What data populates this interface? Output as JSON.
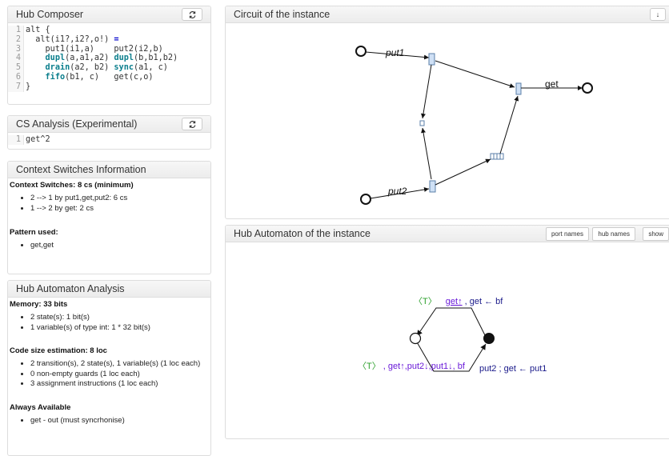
{
  "hub_composer": {
    "title": "Hub Composer",
    "line_numbers": [
      "1",
      "2",
      "3",
      "4",
      "5",
      "6",
      "7"
    ],
    "code": {
      "l1": "alt {",
      "l2a": "  alt(i1?,i2?,o!) ",
      "l2b": "=",
      "l3": "    put1(i1,a)    put2(i2,b)",
      "l4_kw1": "dupl",
      "l4_a": "(a,a1,a2) ",
      "l4_kw2": "dupl",
      "l4_b": "(b,b1,b2)",
      "l5_kw1": "drain",
      "l5_a": "(a2, b2) ",
      "l5_kw2": "sync",
      "l5_b": "(a1, c)",
      "l6_kw1": "fifo",
      "l6_a": "(b1, c)   get(c,o)",
      "l7": "}"
    }
  },
  "cs_analysis": {
    "title": "CS Analysis (Experimental)",
    "line_number": "1",
    "query": "get^2"
  },
  "context_switches": {
    "title": "Context Switches Information",
    "heading": "Context Switches: 8 cs (minimum)",
    "items": [
      "2 --> 1 by put1,get,put2: 6 cs",
      "1 --> 2 by get: 2 cs"
    ],
    "pattern_heading": "Pattern used:",
    "pattern_items": [
      "get,get"
    ]
  },
  "hub_automaton_analysis": {
    "title": "Hub Automaton Analysis",
    "memory_heading": "Memory: 33 bits",
    "memory_items": [
      "2 state(s): 1 bit(s)",
      "1 variable(s) of type int: 1 * 32 bit(s)"
    ],
    "code_heading": "Code size estimation: 8 loc",
    "code_items": [
      "2 transition(s), 2 state(s), 1 variable(s) (1 loc each)",
      "0 non-empty guards (1 loc each)",
      "3 assignment instructions (1 loc each)"
    ],
    "always_heading": "Always Available",
    "always_items": [
      "get - out (must syncrhonise)"
    ]
  },
  "circuit": {
    "title": "Circuit of the instance",
    "download_icon": "download-icon",
    "labels": {
      "put1": "put1",
      "put2": "put2",
      "get": "get"
    }
  },
  "automaton": {
    "title": "Hub Automaton of the instance",
    "buttons": {
      "port_names": "port names",
      "hub_names": "hub names",
      "show": "show"
    },
    "top_guard": "〈T〉",
    "top_ports": "get↑",
    "top_action": ", get ← bf",
    "bottom_guard": "〈T〉",
    "bottom_ports": ", get↑,put2↓,put1↓, bf",
    "bottom_action": "put2 ; get ← put1",
    "colors": {
      "guard": "#2ca02c",
      "ports": "#6a1bd8",
      "action": "#1a1a8a"
    }
  },
  "icons": {
    "refresh": "refresh-icon"
  }
}
